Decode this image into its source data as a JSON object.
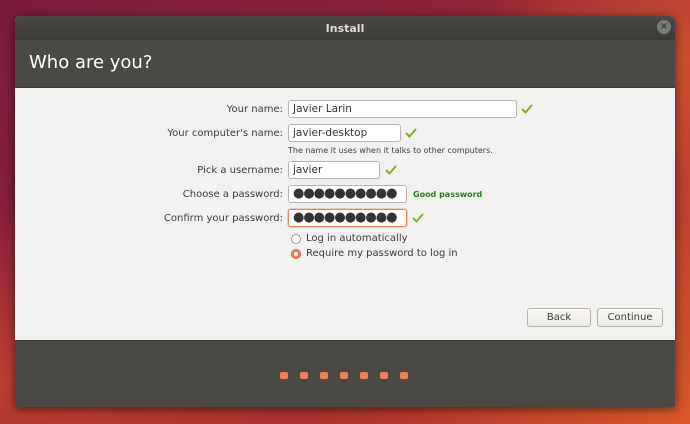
{
  "window": {
    "title": "Install"
  },
  "header": {
    "heading": "Who are you?"
  },
  "form": {
    "name_label": "Your name:",
    "name_value": "Javier Larin",
    "computer_label": "Your computer's name:",
    "computer_value": "javier-desktop",
    "computer_hint": "The name it uses when it talks to other computers.",
    "username_label": "Pick a username:",
    "username_value": "javier",
    "password_label": "Choose a password:",
    "password_value": "●●●●●●●●●●",
    "password_strength": "Good password",
    "confirm_label": "Confirm your password:",
    "confirm_value": "●●●●●●●●●●"
  },
  "login_options": [
    {
      "label": "Log in automatically",
      "selected": false
    },
    {
      "label": "Require my password to log in",
      "selected": true
    }
  ],
  "buttons": {
    "back": "Back",
    "continue": "Continue"
  },
  "colors": {
    "accent": "#e9835b",
    "check": "#7db02d",
    "good": "#2d7a21",
    "header": "#4a4944"
  },
  "icons": {
    "valid": "check-icon",
    "close": "close-icon"
  },
  "progress": {
    "steps": 7
  }
}
